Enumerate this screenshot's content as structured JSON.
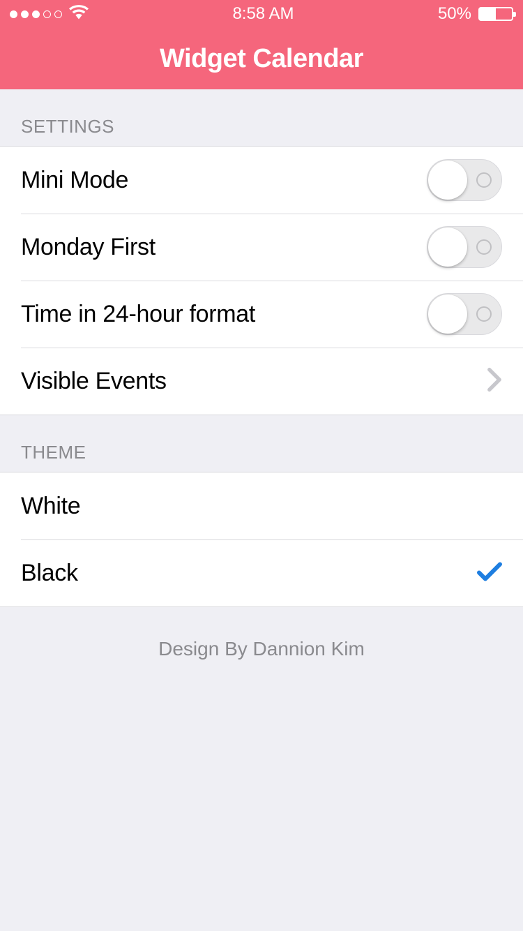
{
  "status_bar": {
    "time": "8:58 AM",
    "battery_percent": "50%"
  },
  "nav": {
    "title": "Widget Calendar"
  },
  "sections": {
    "settings": {
      "header": "SETTINGS",
      "mini_mode": "Mini Mode",
      "monday_first": "Monday First",
      "time_24h": "Time in 24-hour format",
      "visible_events": "Visible Events"
    },
    "theme": {
      "header": "THEME",
      "white": "White",
      "black": "Black"
    }
  },
  "footer": {
    "credit": "Design By Dannion Kim"
  },
  "colors": {
    "accent": "#f5667c",
    "check": "#1e7ee0"
  }
}
